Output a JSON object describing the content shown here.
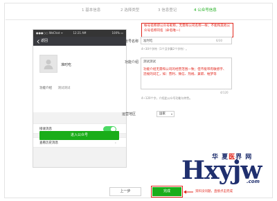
{
  "steps": [
    {
      "label": "1 基本信息"
    },
    {
      "label": "2 选择类型"
    },
    {
      "label": "3 信息登记"
    },
    {
      "label": "4 公众号信息"
    }
  ],
  "phone": {
    "carrier": "●●●○○ WeChat ᯤ",
    "time": "12:21 AM",
    "battery": "100% ▭",
    "back_label": "返回",
    "nickname": "准时吃",
    "intro_label": "功能介绍",
    "intro_value": "测试测试",
    "receive_messages_label": "接收消息",
    "receive_messages_on": true,
    "history_label": "查看历史消息",
    "enter_button": "进入公众号"
  },
  "form": {
    "account_name_label": "帐号名称",
    "account_name_value": "准时吃",
    "account_name_counter": "6/30",
    "account_name_hint": "4~30个字符（1个汉字算2个字符）。",
    "account_name_note": "帐号名称即公众号昵称，无需和公司名称一样；不能和其他公众号名称同名（命名唯一）",
    "intro_label": "功能介绍",
    "intro_value": "测试测试",
    "intro_note": "功能介绍无需和公司的经营范围一致；但不能带有敏感字、违规的词汇，如：营利、微信、热线、兼职、帕梦等",
    "intro_counter": "4/120",
    "intro_hint": "4~120个字，介绍此公众号功能与特色。",
    "region_label": "运营地区",
    "region_value": "国家"
  },
  "footer": {
    "prev_button": "上一步",
    "finish_button": "完成",
    "finish_note": "资料没问题，直接点击完成"
  },
  "watermark": {
    "top_text": "华 夏",
    "top_mid": "医",
    "top_end": "界 网",
    "main": "Hxyjw",
    "suffix": ".com"
  },
  "colors": {
    "accent_green": "#1aad19",
    "note_red": "#e1251b",
    "toggle_green": "#4cd964",
    "watermark_navy": "#1f2f6e"
  }
}
